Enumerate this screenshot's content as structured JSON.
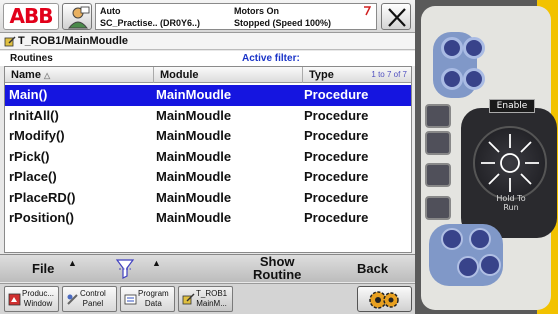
{
  "topbar": {
    "logo": "ABB",
    "mode": "Auto",
    "system": "SC_Practise.. (DR0Y6..)",
    "motors": "Motors On",
    "state": "Stopped (Speed 100%)"
  },
  "title": "T_ROB1/MainMoudle",
  "section": {
    "routines": "Routines",
    "active_filter": "Active filter:"
  },
  "table": {
    "headers": {
      "name": "Name",
      "module": "Module",
      "type": "Type"
    },
    "count": "1 to 7 of 7",
    "rows": [
      {
        "name": "Main()",
        "module": "MainMoudle",
        "type": "Procedure",
        "selected": true
      },
      {
        "name": "rInitAll()",
        "module": "MainMoudle",
        "type": "Procedure",
        "selected": false
      },
      {
        "name": "rModify()",
        "module": "MainMoudle",
        "type": "Procedure",
        "selected": false
      },
      {
        "name": "rPick()",
        "module": "MainMoudle",
        "type": "Procedure",
        "selected": false
      },
      {
        "name": "rPlace()",
        "module": "MainMoudle",
        "type": "Procedure",
        "selected": false
      },
      {
        "name": "rPlaceRD()",
        "module": "MainMoudle",
        "type": "Procedure",
        "selected": false
      },
      {
        "name": "rPosition()",
        "module": "MainMoudle",
        "type": "Procedure",
        "selected": false
      }
    ]
  },
  "bottombar": {
    "file": "File",
    "show_routine_line1": "Show",
    "show_routine_line2": "Routine",
    "back": "Back"
  },
  "taskbar": {
    "production_l1": "Produc...",
    "production_l2": "Window",
    "control_l1": "Control",
    "control_l2": "Panel",
    "program_l1": "Program",
    "program_l2": "Data",
    "trob_l1": "T_ROB1",
    "trob_l2": "MainM..."
  },
  "pendant": {
    "enable": "Enable",
    "hold_l1": "Hold To",
    "hold_l2": "Run"
  },
  "colors": {
    "selected": "#1515e0",
    "abb_red": "#e2001a",
    "filter_blue": "#1a34c8"
  }
}
